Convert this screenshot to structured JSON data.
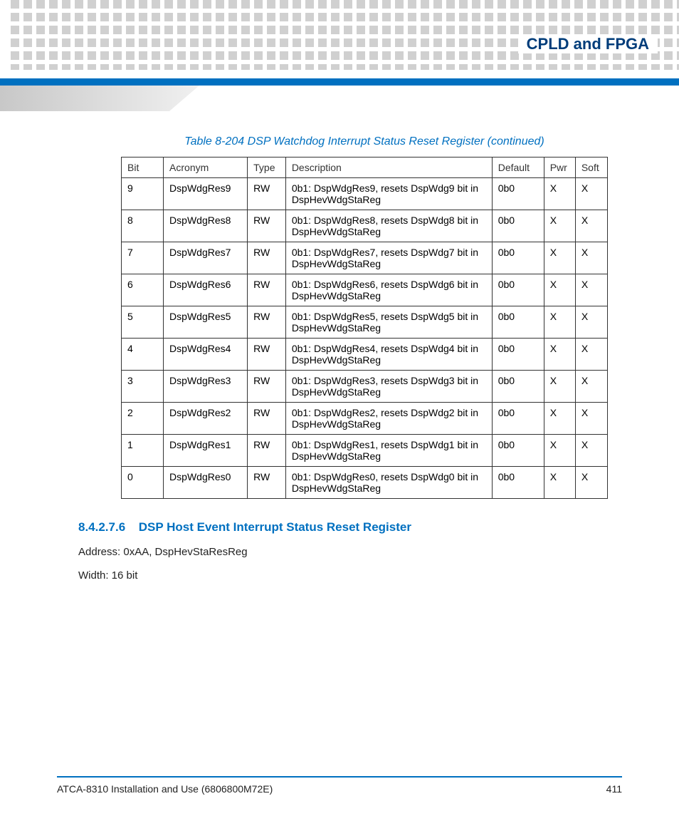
{
  "chapter_title": "CPLD and FPGA",
  "table_title": "Table 8-204 DSP Watchdog Interrupt Status Reset Register (continued)",
  "columns": [
    "Bit",
    "Acronym",
    "Type",
    "Description",
    "Default",
    "Pwr",
    "Soft"
  ],
  "rows": [
    {
      "bit": "9",
      "acronym": "DspWdgRes9",
      "type": "RW",
      "desc": "0b1: DspWdgRes9, resets DspWdg9 bit in DspHevWdgStaReg",
      "default": "0b0",
      "pwr": "X",
      "soft": "X"
    },
    {
      "bit": "8",
      "acronym": "DspWdgRes8",
      "type": "RW",
      "desc": "0b1: DspWdgRes8, resets DspWdg8 bit in DspHevWdgStaReg",
      "default": "0b0",
      "pwr": "X",
      "soft": "X"
    },
    {
      "bit": "7",
      "acronym": "DspWdgRes7",
      "type": "RW",
      "desc": "0b1: DspWdgRes7, resets DspWdg7 bit in DspHevWdgStaReg",
      "default": "0b0",
      "pwr": "X",
      "soft": "X"
    },
    {
      "bit": "6",
      "acronym": "DspWdgRes6",
      "type": "RW",
      "desc": "0b1: DspWdgRes6, resets DspWdg6 bit in DspHevWdgStaReg",
      "default": "0b0",
      "pwr": "X",
      "soft": "X"
    },
    {
      "bit": "5",
      "acronym": "DspWdgRes5",
      "type": "RW",
      "desc": "0b1: DspWdgRes5, resets DspWdg5 bit in DspHevWdgStaReg",
      "default": "0b0",
      "pwr": "X",
      "soft": "X"
    },
    {
      "bit": "4",
      "acronym": "DspWdgRes4",
      "type": "RW",
      "desc": "0b1: DspWdgRes4, resets DspWdg4 bit in DspHevWdgStaReg",
      "default": "0b0",
      "pwr": "X",
      "soft": "X"
    },
    {
      "bit": "3",
      "acronym": "DspWdgRes3",
      "type": "RW",
      "desc": "0b1: DspWdgRes3, resets DspWdg3 bit in DspHevWdgStaReg",
      "default": "0b0",
      "pwr": "X",
      "soft": "X"
    },
    {
      "bit": "2",
      "acronym": "DspWdgRes2",
      "type": "RW",
      "desc": "0b1: DspWdgRes2, resets DspWdg2 bit in DspHevWdgStaReg",
      "default": "0b0",
      "pwr": "X",
      "soft": "X"
    },
    {
      "bit": "1",
      "acronym": "DspWdgRes1",
      "type": "RW",
      "desc": "0b1: DspWdgRes1, resets DspWdg1 bit in DspHevWdgStaReg",
      "default": "0b0",
      "pwr": "X",
      "soft": "X"
    },
    {
      "bit": "0",
      "acronym": "DspWdgRes0",
      "type": "RW",
      "desc": "0b1: DspWdgRes0, resets DspWdg0 bit in DspHevWdgStaReg",
      "default": "0b0",
      "pwr": "X",
      "soft": "X"
    }
  ],
  "section": {
    "number": "8.4.2.7.6",
    "title": "DSP Host Event Interrupt Status Reset Register",
    "address": "Address: 0xAA, DspHevStaResReg",
    "width": "Width: 16 bit"
  },
  "footer": {
    "doc": "ATCA-8310 Installation and Use (6806800M72E)",
    "page": "411"
  }
}
